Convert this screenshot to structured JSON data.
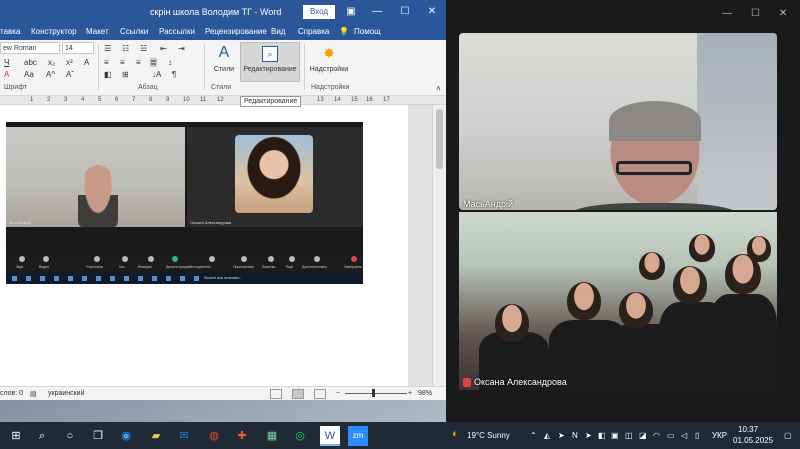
{
  "word": {
    "title": "скрін школа Володим ТГ  -  Word",
    "login_label": "Вход",
    "menu": [
      "тавка",
      "Конструктор",
      "Макет",
      "Ссылки",
      "Рассылки",
      "Рецензирование",
      "Вид",
      "Справка",
      "Помощ"
    ],
    "font_name": "ew Roman",
    "font_size": "14",
    "groups": {
      "font": "Шрифт",
      "paragraph": "Абзац",
      "styles": "Стили",
      "addins": "Надстройки"
    },
    "styles_label": "Стили",
    "editing_label": "Редактирование",
    "addins_label": "Надстройки",
    "tooltip": "Редактирование",
    "ruler_marks": [
      "1",
      "2",
      "3",
      "4",
      "5",
      "6",
      "7",
      "8",
      "9",
      "10",
      "11",
      "12",
      "13",
      "14",
      "15",
      "16",
      "17"
    ],
    "status": {
      "words": "слов: 0",
      "language": "украинский",
      "zoom": "98%"
    }
  },
  "embedded_shot": {
    "left_name": "МасьАндрій",
    "right_name": "Оксана Александрова",
    "toolbar_items": [
      "Звук",
      "Видео",
      "Участники",
      "Чат",
      "Реакции",
      "Демонстрация",
      "Инструменты",
      "Приложения",
      "Заметки",
      "Ещё",
      "Дополнительно",
      "Завершить"
    ],
    "taskbar_text": "Student and recreation..."
  },
  "zoom": {
    "participant1": "МасьАндрій",
    "participant2": "Оксана Александрова"
  },
  "taskbar": {
    "weather": "19°C  Sunny",
    "language": "УКР",
    "time": "10:37",
    "date": "01.05.2025"
  },
  "colors": {
    "word_blue": "#2b579a",
    "taskbar": "#1f2a36"
  }
}
